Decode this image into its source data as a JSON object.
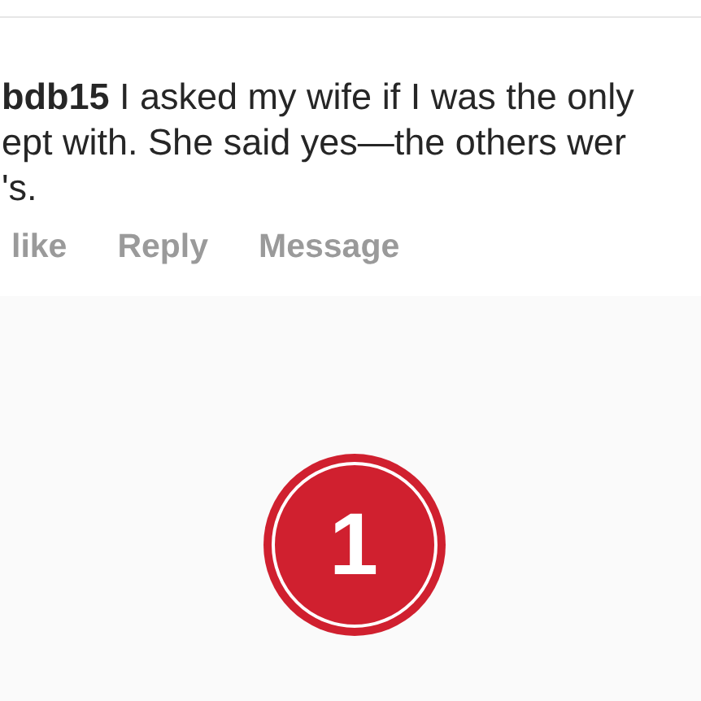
{
  "comment": {
    "lines": [
      "**bdb15** I asked my wife if I was the only",
      "ept with. She said yes—the others wer",
      "'s."
    ]
  },
  "actions": [
    {
      "label": "like"
    },
    {
      "label": "Reply"
    },
    {
      "label": "Message"
    }
  ],
  "badge": {
    "text": "1",
    "color": "#d0202f"
  }
}
